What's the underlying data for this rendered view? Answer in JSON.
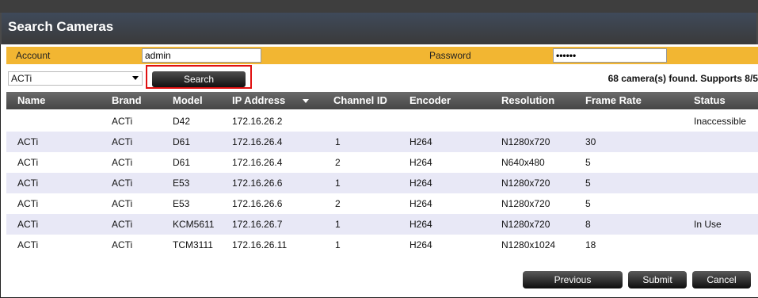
{
  "window": {
    "title": "Search Cameras"
  },
  "account": {
    "account_label": "Account",
    "account_value": "admin",
    "password_label": "Password",
    "password_value": "••••••"
  },
  "search": {
    "brand_selected": "ACTi",
    "search_label": "Search",
    "found_text": "68 camera(s) found.  Supports 8/5"
  },
  "table": {
    "columns": [
      "Name",
      "Brand",
      "Model",
      "IP Address",
      "Channel ID",
      "Encoder",
      "Resolution",
      "Frame Rate",
      "Status"
    ],
    "rows": [
      [
        "",
        "ACTi",
        "D42",
        "172.16.26.2",
        "",
        "",
        "",
        "",
        "Inaccessible"
      ],
      [
        "ACTi",
        "ACTi",
        "D61",
        "172.16.26.4",
        "1",
        "H264",
        "N1280x720",
        "30",
        ""
      ],
      [
        "ACTi",
        "ACTi",
        "D61",
        "172.16.26.4",
        "2",
        "H264",
        "N640x480",
        "5",
        ""
      ],
      [
        "ACTi",
        "ACTi",
        "E53",
        "172.16.26.6",
        "1",
        "H264",
        "N1280x720",
        "5",
        ""
      ],
      [
        "ACTi",
        "ACTi",
        "E53",
        "172.16.26.6",
        "2",
        "H264",
        "N1280x720",
        "5",
        ""
      ],
      [
        "ACTi",
        "ACTi",
        "KCM5611",
        "172.16.26.7",
        "1",
        "H264",
        "N1280x720",
        "8",
        "In Use"
      ],
      [
        "ACTi",
        "ACTi",
        "TCM3111",
        "172.16.26.11",
        "1",
        "H264",
        "N1280x1024",
        "18",
        ""
      ]
    ]
  },
  "footer": {
    "previous_label": "Previous",
    "submit_label": "Submit",
    "cancel_label": "Cancel"
  },
  "colors": {
    "accent_bar": "#f2b632",
    "highlight_box": "#e01010",
    "alt_row": "#e8e8f6"
  }
}
